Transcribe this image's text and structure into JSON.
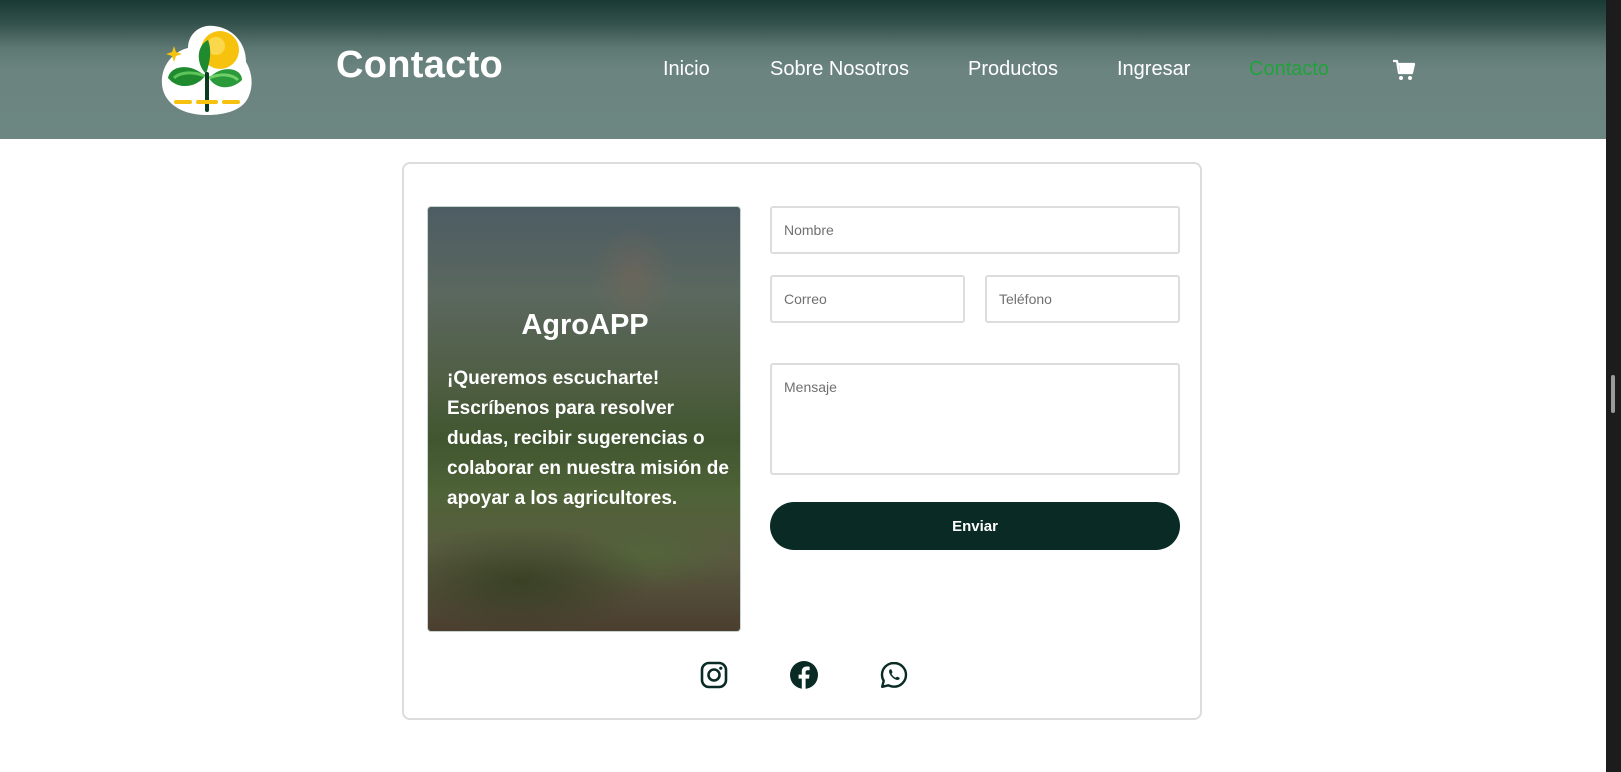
{
  "header": {
    "title": "Contacto",
    "nav": [
      {
        "label": "Inicio",
        "active": false
      },
      {
        "label": "Sobre Nosotros",
        "active": false
      },
      {
        "label": "Productos",
        "active": false
      },
      {
        "label": "Ingresar",
        "active": false
      },
      {
        "label": "Contacto",
        "active": true
      }
    ],
    "active_color": "#1fa33a",
    "cart_icon": "shopping-cart-icon",
    "logo_icon": "sprout-sun-logo"
  },
  "promo": {
    "title": "AgroAPP",
    "text": "¡Queremos escucharte! Escríbenos para resolver dudas, recibir sugerencias o colaborar en nuestra misión de apoyar a los agricultores."
  },
  "form": {
    "nombre_placeholder": "Nombre",
    "correo_placeholder": "Correo",
    "telefono_placeholder": "Teléfono",
    "mensaje_placeholder": "Mensaje",
    "nombre_value": "",
    "correo_value": "",
    "telefono_value": "",
    "mensaje_value": "",
    "submit_label": "Enviar",
    "submit_color": "#0a2b25"
  },
  "social": [
    {
      "icon": "instagram-icon"
    },
    {
      "icon": "facebook-icon"
    },
    {
      "icon": "whatsapp-icon"
    }
  ]
}
